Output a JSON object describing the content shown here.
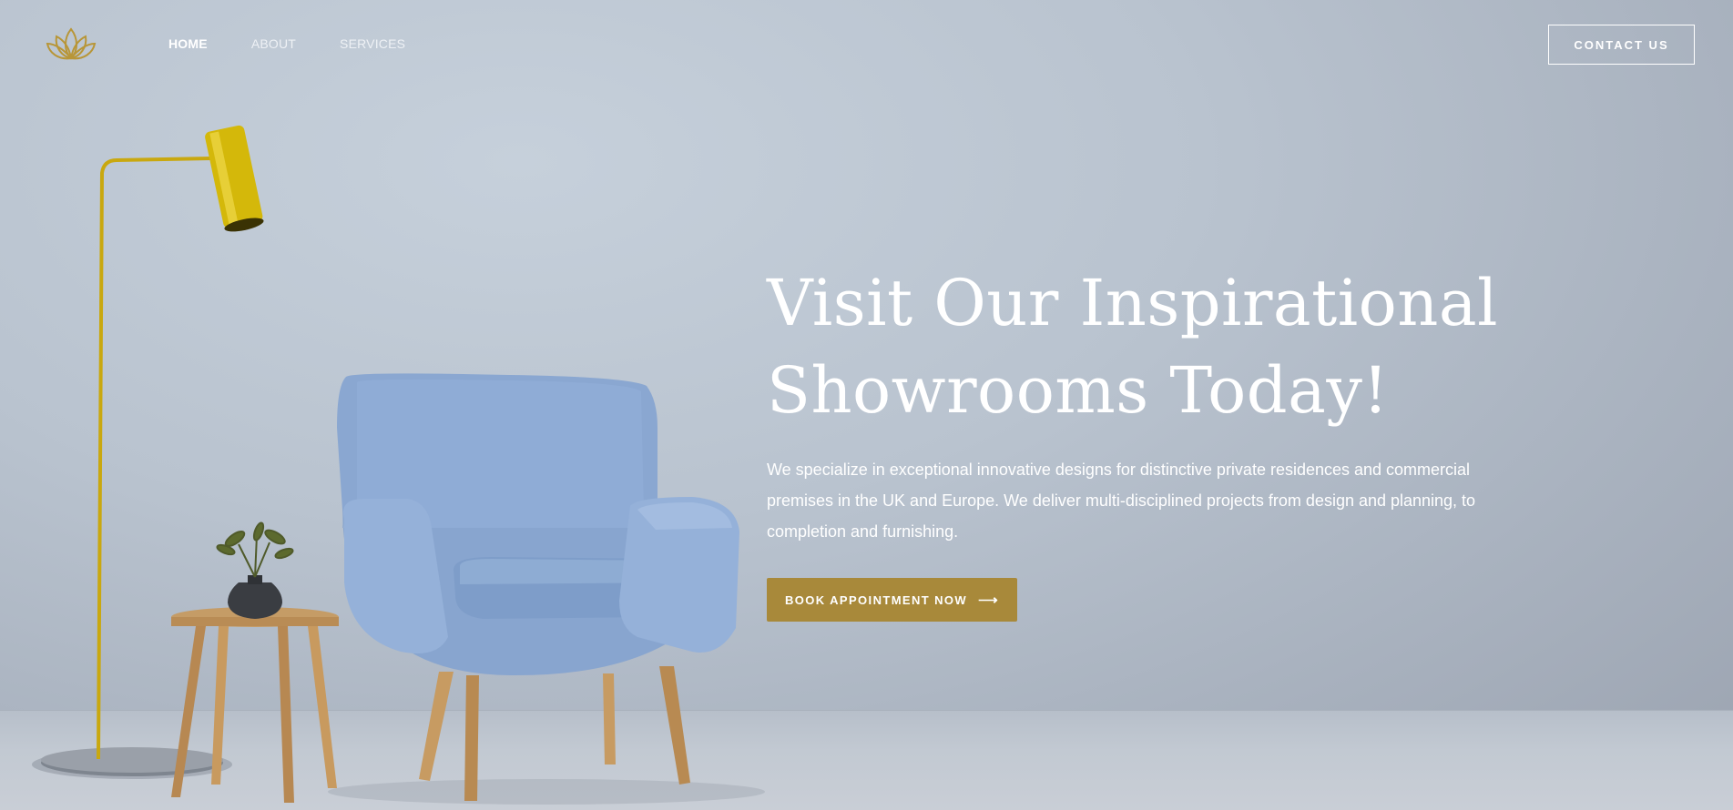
{
  "header": {
    "logo_icon": "lotus-icon",
    "nav": [
      {
        "label": "HOME",
        "active": true
      },
      {
        "label": "ABOUT",
        "active": false
      },
      {
        "label": "SERVICES",
        "active": false
      }
    ],
    "contact_label": "CONTACT US"
  },
  "hero": {
    "headline_line1": "Visit Our Inspirational",
    "headline_line2": "Showrooms Today!",
    "description": "We specialize in exceptional innovative designs for distinctive private residences and commercial premises in the UK and Europe. We deliver multi-disciplined projects from design and planning, to completion and furnishing.",
    "cta_label": "BOOK APPOINTMENT NOW",
    "cta_icon": "arrow-right-icon"
  },
  "colors": {
    "accent_gold": "#a8893a",
    "wall": "#b9c3cf",
    "chair_blue": "#8ba9d3",
    "text": "#ffffff"
  }
}
